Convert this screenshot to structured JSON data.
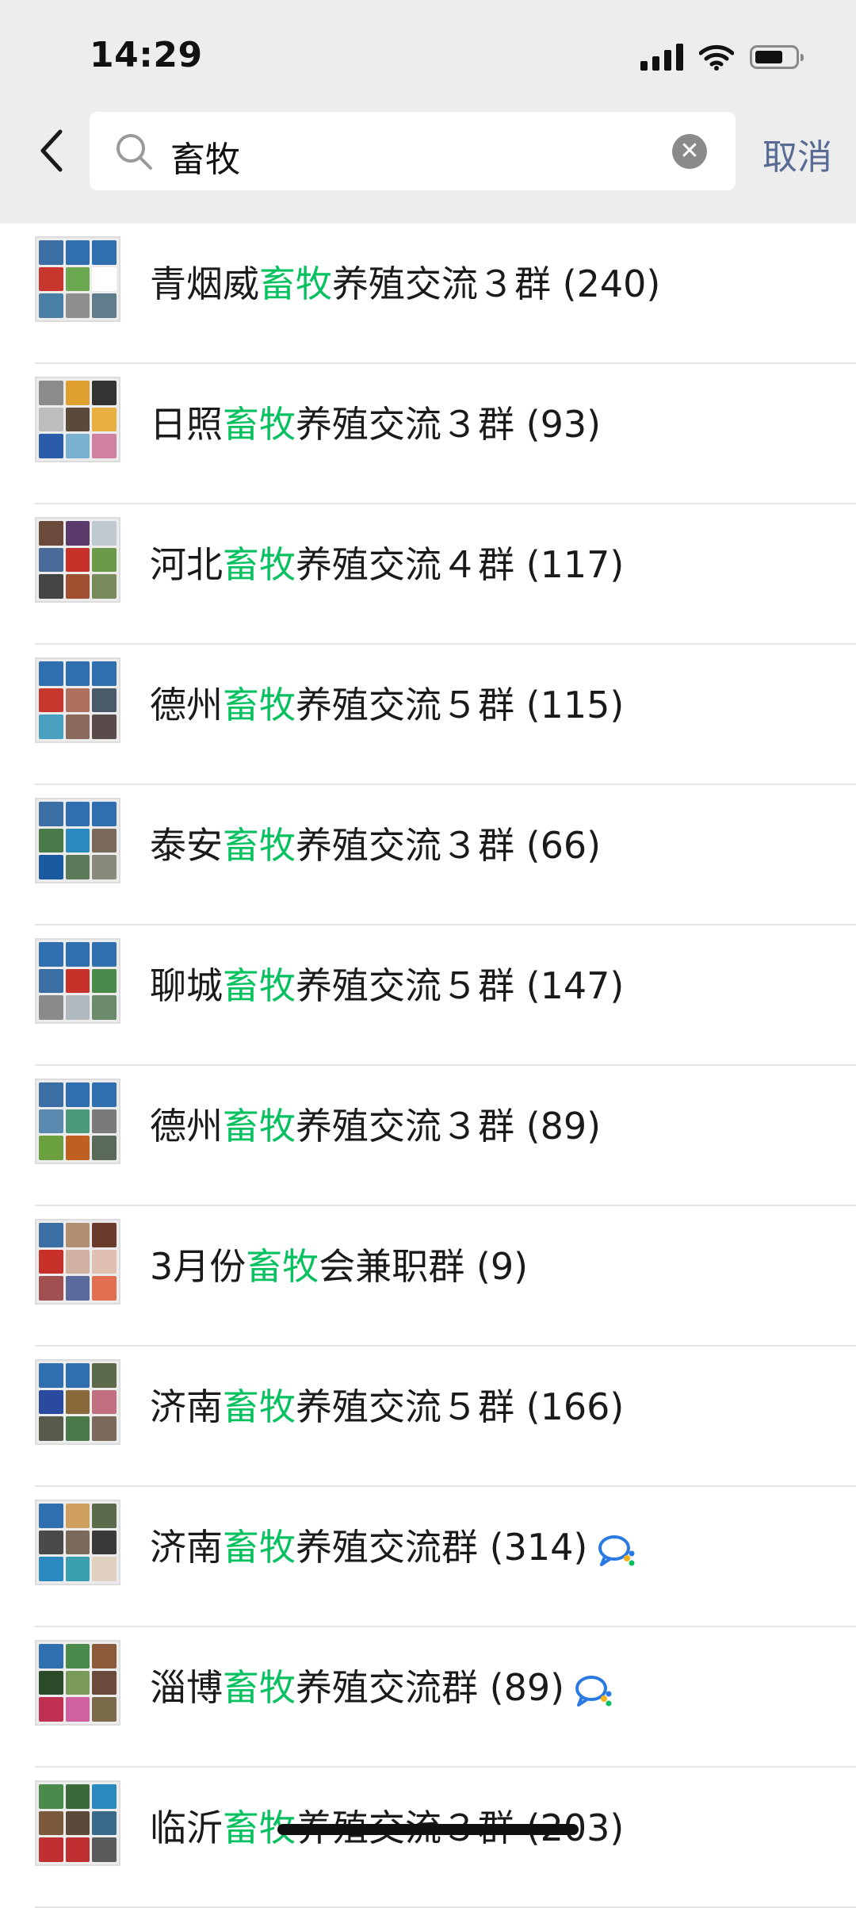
{
  "status_bar": {
    "time": "14:29"
  },
  "search": {
    "query": "畜牧",
    "cancel_label": "取消"
  },
  "results": [
    {
      "prefix": "青烟威",
      "highlight": "畜牧",
      "suffix": "养殖交流３群 (240)",
      "wecom": false,
      "avatar_colors": [
        "#3a6ea5",
        "#2f6fb0",
        "#2f6fb0",
        "#c8372d",
        "#6aa84f",
        "#ffffff",
        "#4a7fa5",
        "#8f8f8f",
        "#607d8b"
      ]
    },
    {
      "prefix": "日照",
      "highlight": "畜牧",
      "suffix": "养殖交流３群 (93)",
      "wecom": false,
      "avatar_colors": [
        "#8b8b8b",
        "#e0a030",
        "#333333",
        "#bdbdbd",
        "#5a4a3a",
        "#e8b040",
        "#2a5caa",
        "#7ab0d0",
        "#d080a0"
      ]
    },
    {
      "prefix": "河北",
      "highlight": "畜牧",
      "suffix": "养殖交流４群 (117)",
      "wecom": false,
      "avatar_colors": [
        "#6a4a3a",
        "#5a3a6a",
        "#c0c8d0",
        "#4a6a9a",
        "#c8302a",
        "#6a9a4a",
        "#444444",
        "#a05030",
        "#7a8a5a"
      ]
    },
    {
      "prefix": "德州",
      "highlight": "畜牧",
      "suffix": "养殖交流５群 (115)",
      "wecom": false,
      "avatar_colors": [
        "#2f6fb0",
        "#2f6fb0",
        "#2f6fb0",
        "#c8372d",
        "#b07060",
        "#4a5a6a",
        "#4aa0c0",
        "#8a6a5a",
        "#5a4a4a"
      ]
    },
    {
      "prefix": "泰安",
      "highlight": "畜牧",
      "suffix": "养殖交流３群 (66)",
      "wecom": false,
      "avatar_colors": [
        "#3a6ea5",
        "#2f6fb0",
        "#2f6fb0",
        "#4a7a4a",
        "#2a8ac0",
        "#7a6a5a",
        "#1a5aa0",
        "#5a7a5a",
        "#8a8a7a"
      ]
    },
    {
      "prefix": "聊城",
      "highlight": "畜牧",
      "suffix": "养殖交流５群 (147)",
      "wecom": false,
      "avatar_colors": [
        "#2f6fb0",
        "#2f6fb0",
        "#2f6fb0",
        "#3a6ea5",
        "#c8302a",
        "#4a8a4a",
        "#8a8a8a",
        "#b0b8c0",
        "#6a8a6a"
      ]
    },
    {
      "prefix": "德州",
      "highlight": "畜牧",
      "suffix": "养殖交流３群 (89)",
      "wecom": false,
      "avatar_colors": [
        "#3a6ea5",
        "#2f6fb0",
        "#2f6fb0",
        "#5a8ab0",
        "#4a9a7a",
        "#7a7a7a",
        "#6aa040",
        "#c06020",
        "#5a6a5a"
      ]
    },
    {
      "prefix": "3月份",
      "highlight": "畜牧",
      "suffix": "会兼职群 (9)",
      "wecom": false,
      "avatar_colors": [
        "#3a6ea5",
        "#b09070",
        "#6a3a2a",
        "#c8302a",
        "#d0b0a0",
        "#e0c0b0",
        "#a05050",
        "#5a6a9a",
        "#e07050"
      ]
    },
    {
      "prefix": "济南",
      "highlight": "畜牧",
      "suffix": "养殖交流５群 (166)",
      "wecom": false,
      "avatar_colors": [
        "#2f6fb0",
        "#2f6fb0",
        "#5a6a4a",
        "#2a4aa0",
        "#8a6a3a",
        "#c07080",
        "#5a5a4a",
        "#4a7a4a",
        "#7a6a5a"
      ]
    },
    {
      "prefix": "济南",
      "highlight": "畜牧",
      "suffix": "养殖交流群 (314)",
      "wecom": true,
      "avatar_colors": [
        "#2f6fb0",
        "#d0a060",
        "#5a6a4a",
        "#4a4a4a",
        "#7a6a5a",
        "#3a3a3a",
        "#2a8ac0",
        "#3aa0b0",
        "#e0d0c0"
      ]
    },
    {
      "prefix": "淄博",
      "highlight": "畜牧",
      "suffix": "养殖交流群 (89)",
      "wecom": true,
      "avatar_colors": [
        "#2f6fb0",
        "#4a8a4a",
        "#8a5a3a",
        "#2a4a2a",
        "#7a9a5a",
        "#6a4a3a",
        "#c03050",
        "#d060a0",
        "#7a6a4a"
      ]
    },
    {
      "prefix": "临沂",
      "highlight": "畜牧",
      "suffix": "养殖交流３群 (203)",
      "wecom": false,
      "avatar_colors": [
        "#4a8a4a",
        "#3a6a3a",
        "#2a8ac0",
        "#7a5a3a",
        "#5a4a3a",
        "#3a6a8a",
        "#c03030",
        "#c03030",
        "#5a5a5a"
      ]
    }
  ]
}
